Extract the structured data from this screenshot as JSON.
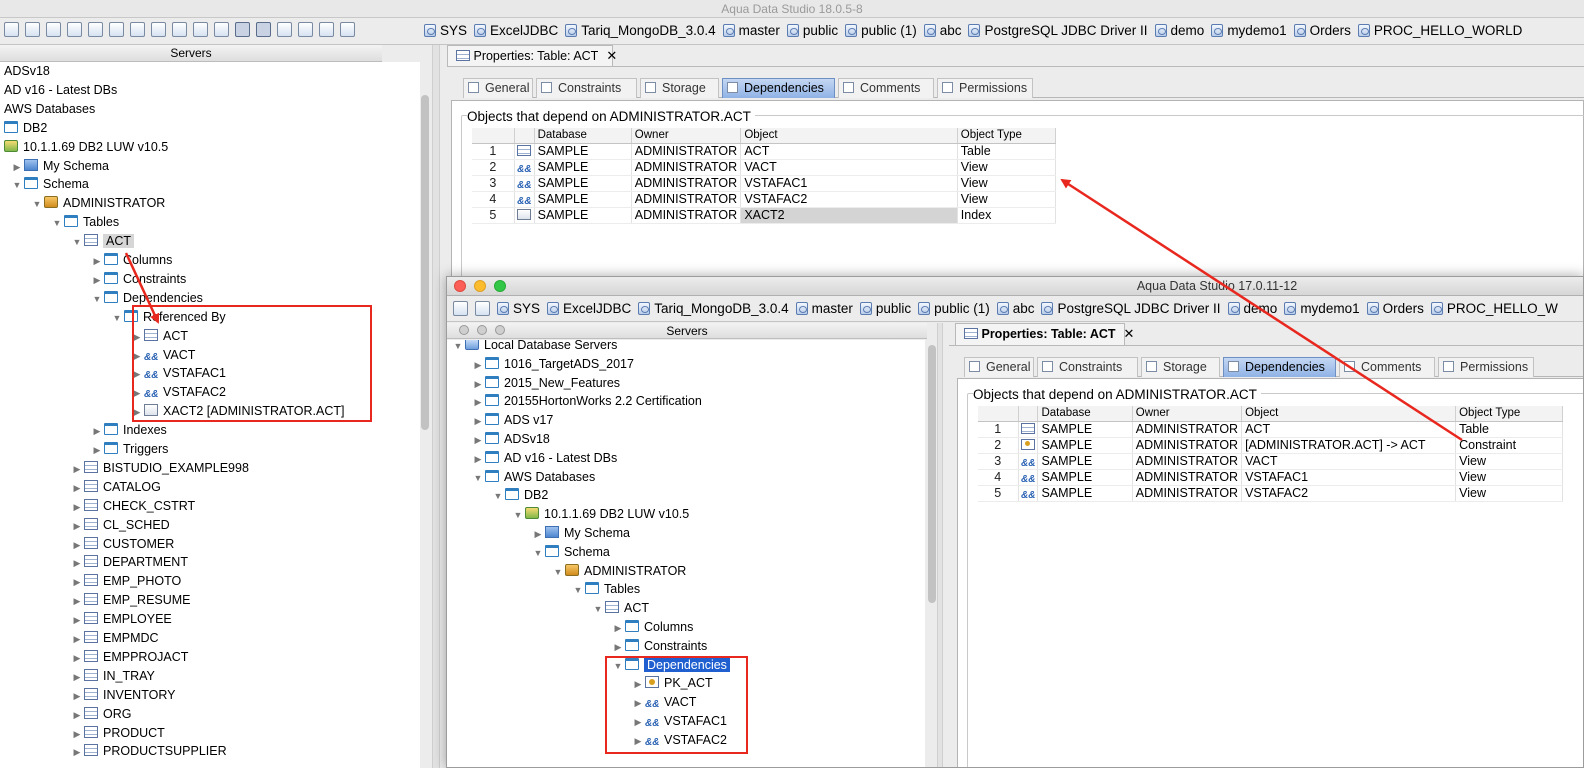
{
  "main_window": {
    "title": "Aqua Data Studio 18.0.5-8",
    "connections": [
      "SYS",
      "ExcelJDBC",
      "Tariq_MongoDB_3.0.4",
      "master",
      "public",
      "public (1)",
      "abc",
      "PostgreSQL JDBC Driver II",
      "demo",
      "mydemo1",
      "Orders",
      "PROC_HELLO_WORLD"
    ],
    "servers_header": "Servers",
    "tree": [
      {
        "label": "ADSv18",
        "icon": "none",
        "arrow": "",
        "depth": 0
      },
      {
        "label": "AD v16 - Latest DBs",
        "icon": "none",
        "arrow": "",
        "depth": 0
      },
      {
        "label": "AWS Databases",
        "icon": "none",
        "arrow": "",
        "depth": 0
      },
      {
        "label": "DB2",
        "icon": "folder",
        "arrow": "",
        "depth": 0
      },
      {
        "label": "10.1.1.69 DB2 LUW v10.5",
        "icon": "srvg",
        "arrow": "▼",
        "depth": 0
      },
      {
        "label": "My Schema",
        "icon": "schema",
        "arrow": "▶",
        "depth": 1
      },
      {
        "label": "Schema",
        "icon": "folder",
        "arrow": "▼",
        "depth": 1
      },
      {
        "label": "ADMINISTRATOR",
        "icon": "server",
        "arrow": "▼",
        "depth": 2
      },
      {
        "label": "Tables",
        "icon": "folder",
        "arrow": "▼",
        "depth": 3
      },
      {
        "label": "ACT",
        "icon": "table",
        "arrow": "▼",
        "depth": 4,
        "highlight": "grey"
      },
      {
        "label": "Columns",
        "icon": "folder",
        "arrow": "▶",
        "depth": 5
      },
      {
        "label": "Constraints",
        "icon": "folder",
        "arrow": "▶",
        "depth": 5
      },
      {
        "label": "Dependencies",
        "icon": "folder",
        "arrow": "▼",
        "depth": 5
      },
      {
        "label": "Referenced By",
        "icon": "folder",
        "arrow": "▼",
        "depth": 6
      },
      {
        "label": "ACT",
        "icon": "table",
        "arrow": "▶",
        "depth": 7
      },
      {
        "label": "VACT",
        "icon": "view",
        "arrow": "▶",
        "depth": 7
      },
      {
        "label": "VSTAFAC1",
        "icon": "view",
        "arrow": "▶",
        "depth": 7
      },
      {
        "label": "VSTAFAC2",
        "icon": "view",
        "arrow": "▶",
        "depth": 7
      },
      {
        "label": "XACT2 [ADMINISTRATOR.ACT]",
        "icon": "idx",
        "arrow": "▶",
        "depth": 7
      },
      {
        "label": "Indexes",
        "icon": "folder",
        "arrow": "▶",
        "depth": 5
      },
      {
        "label": "Triggers",
        "icon": "folder",
        "arrow": "▶",
        "depth": 5
      },
      {
        "label": "BISTUDIO_EXAMPLE998",
        "icon": "table",
        "arrow": "▶",
        "depth": 4
      },
      {
        "label": "CATALOG",
        "icon": "table",
        "arrow": "▶",
        "depth": 4
      },
      {
        "label": "CHECK_CSTRT",
        "icon": "table",
        "arrow": "▶",
        "depth": 4
      },
      {
        "label": "CL_SCHED",
        "icon": "table",
        "arrow": "▶",
        "depth": 4
      },
      {
        "label": "CUSTOMER",
        "icon": "table",
        "arrow": "▶",
        "depth": 4
      },
      {
        "label": "DEPARTMENT",
        "icon": "table",
        "arrow": "▶",
        "depth": 4
      },
      {
        "label": "EMP_PHOTO",
        "icon": "table",
        "arrow": "▶",
        "depth": 4
      },
      {
        "label": "EMP_RESUME",
        "icon": "table",
        "arrow": "▶",
        "depth": 4
      },
      {
        "label": "EMPLOYEE",
        "icon": "table",
        "arrow": "▶",
        "depth": 4
      },
      {
        "label": "EMPMDC",
        "icon": "table",
        "arrow": "▶",
        "depth": 4
      },
      {
        "label": "EMPPROJACT",
        "icon": "table",
        "arrow": "▶",
        "depth": 4
      },
      {
        "label": "IN_TRAY",
        "icon": "table",
        "arrow": "▶",
        "depth": 4
      },
      {
        "label": "INVENTORY",
        "icon": "table",
        "arrow": "▶",
        "depth": 4
      },
      {
        "label": "ORG",
        "icon": "table",
        "arrow": "▶",
        "depth": 4
      },
      {
        "label": "PRODUCT",
        "icon": "table",
        "arrow": "▶",
        "depth": 4
      },
      {
        "label": "PRODUCTSUPPLIER",
        "icon": "table",
        "arrow": "▶",
        "depth": 4
      }
    ],
    "properties_tab": "Properties: Table: ACT",
    "subtabs": [
      "General",
      "Constraints",
      "Storage",
      "Dependencies",
      "Comments",
      "Permissions"
    ],
    "active_subtab": "Dependencies",
    "group_title": "Objects that depend on ADMINISTRATOR.ACT",
    "columns": [
      "Database",
      "Owner",
      "Object",
      "Object Type"
    ],
    "rows": [
      {
        "n": "1",
        "icon": "table",
        "db": "SAMPLE",
        "owner": "ADMINISTRATOR",
        "object": "ACT",
        "type": "Table"
      },
      {
        "n": "2",
        "icon": "view",
        "db": "SAMPLE",
        "owner": "ADMINISTRATOR",
        "object": "VACT",
        "type": "View"
      },
      {
        "n": "3",
        "icon": "view",
        "db": "SAMPLE",
        "owner": "ADMINISTRATOR",
        "object": "VSTAFAC1",
        "type": "View"
      },
      {
        "n": "4",
        "icon": "view",
        "db": "SAMPLE",
        "owner": "ADMINISTRATOR",
        "object": "VSTAFAC2",
        "type": "View"
      },
      {
        "n": "5",
        "icon": "idx",
        "db": "SAMPLE",
        "owner": "ADMINISTRATOR",
        "object": "XACT2",
        "type": "Index",
        "selected": true
      }
    ]
  },
  "second_window": {
    "title": "Aqua Data Studio 17.0.11-12",
    "connections": [
      "SYS",
      "ExcelJDBC",
      "Tariq_MongoDB_3.0.4",
      "master",
      "public",
      "public (1)",
      "abc",
      "PostgreSQL JDBC Driver II",
      "demo",
      "mydemo1",
      "Orders",
      "PROC_HELLO_W"
    ],
    "servers_header": "Servers",
    "tree": [
      {
        "label": "Local Database Servers",
        "icon": "local",
        "arrow": "▼",
        "depth": 0
      },
      {
        "label": "1016_TargetADS_2017",
        "icon": "folder",
        "arrow": "▶",
        "depth": 1
      },
      {
        "label": "2015_New_Features",
        "icon": "folder",
        "arrow": "▶",
        "depth": 1
      },
      {
        "label": "20155HortonWorks 2.2 Certification",
        "icon": "folder",
        "arrow": "▶",
        "depth": 1
      },
      {
        "label": "ADS v17",
        "icon": "folder",
        "arrow": "▶",
        "depth": 1
      },
      {
        "label": "ADSv18",
        "icon": "folder",
        "arrow": "▶",
        "depth": 1
      },
      {
        "label": "AD v16 - Latest DBs",
        "icon": "folder",
        "arrow": "▶",
        "depth": 1
      },
      {
        "label": "AWS Databases",
        "icon": "folder",
        "arrow": "▼",
        "depth": 1
      },
      {
        "label": "DB2",
        "icon": "folder",
        "arrow": "▼",
        "depth": 2
      },
      {
        "label": "10.1.1.69 DB2 LUW v10.5",
        "icon": "srvg",
        "arrow": "▼",
        "depth": 3
      },
      {
        "label": "My Schema",
        "icon": "schema",
        "arrow": "▶",
        "depth": 4
      },
      {
        "label": "Schema",
        "icon": "folder",
        "arrow": "▼",
        "depth": 4
      },
      {
        "label": "ADMINISTRATOR",
        "icon": "server",
        "arrow": "▼",
        "depth": 5
      },
      {
        "label": "Tables",
        "icon": "folder",
        "arrow": "▼",
        "depth": 6
      },
      {
        "label": "ACT",
        "icon": "table",
        "arrow": "▼",
        "depth": 7
      },
      {
        "label": "Columns",
        "icon": "folder",
        "arrow": "▶",
        "depth": 8
      },
      {
        "label": "Constraints",
        "icon": "folder",
        "arrow": "▶",
        "depth": 8
      },
      {
        "label": "Dependencies",
        "icon": "folder",
        "arrow": "▼",
        "depth": 8,
        "highlight": "blue"
      },
      {
        "label": "PK_ACT",
        "icon": "pk",
        "arrow": "▶",
        "depth": 9
      },
      {
        "label": "VACT",
        "icon": "view",
        "arrow": "▶",
        "depth": 9
      },
      {
        "label": "VSTAFAC1",
        "icon": "view",
        "arrow": "▶",
        "depth": 9
      },
      {
        "label": "VSTAFAC2",
        "icon": "view",
        "arrow": "▶",
        "depth": 9
      }
    ],
    "properties_tab": "Properties: Table: ACT",
    "subtabs": [
      "General",
      "Constraints",
      "Storage",
      "Dependencies",
      "Comments",
      "Permissions"
    ],
    "active_subtab": "Dependencies",
    "group_title": "Objects that depend on ADMINISTRATOR.ACT",
    "columns": [
      "Database",
      "Owner",
      "Object",
      "Object Type"
    ],
    "rows": [
      {
        "n": "1",
        "icon": "table",
        "db": "SAMPLE",
        "owner": "ADMINISTRATOR",
        "object": "ACT",
        "type": "Table"
      },
      {
        "n": "2",
        "icon": "cons",
        "db": "SAMPLE",
        "owner": "ADMINISTRATOR",
        "object": "[ADMINISTRATOR.ACT] -> ACT",
        "type": "Constraint"
      },
      {
        "n": "3",
        "icon": "view",
        "db": "SAMPLE",
        "owner": "ADMINISTRATOR",
        "object": "VACT",
        "type": "View"
      },
      {
        "n": "4",
        "icon": "view",
        "db": "SAMPLE",
        "owner": "ADMINISTRATOR",
        "object": "VSTAFAC1",
        "type": "View"
      },
      {
        "n": "5",
        "icon": "view",
        "db": "SAMPLE",
        "owner": "ADMINISTRATOR",
        "object": "VSTAFAC2",
        "type": "View"
      }
    ]
  },
  "annotation_color": "#e8281e"
}
